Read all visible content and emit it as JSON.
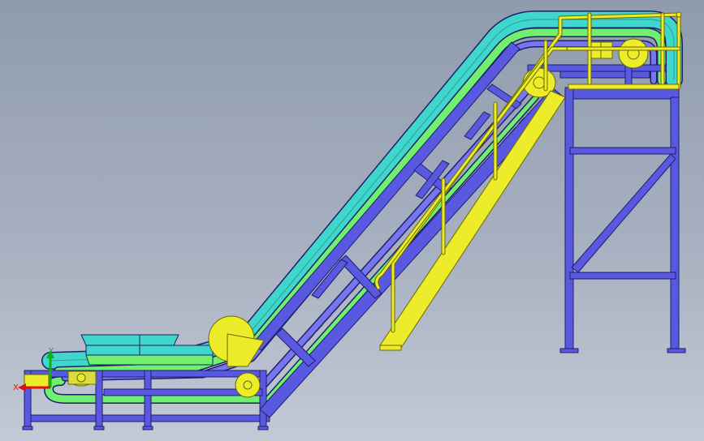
{
  "viewport": {
    "model": "inclined-chain-conveyor-with-platform",
    "colors": {
      "frame": "#5858e0",
      "frame_edge": "#1f1f6a",
      "belt_outer": "#3fd6cc",
      "belt_middle": "#6ff06f",
      "belt_inner": "#7676f0",
      "rails": "#ecec2a",
      "rails_edge": "#6a6a00"
    }
  },
  "triad": {
    "x_label": "X",
    "y_label": "Y",
    "x_color": "#e01010",
    "y_color": "#10b010"
  }
}
